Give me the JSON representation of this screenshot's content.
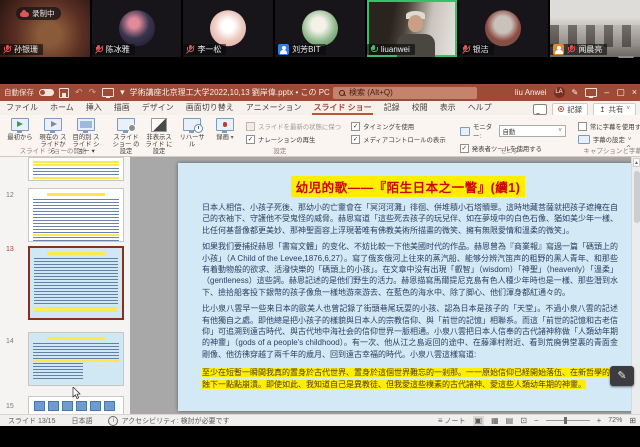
{
  "meeting": {
    "recording_badge": "录制中",
    "participants": [
      {
        "name": "孙银珊",
        "muted": true,
        "kind": "video"
      },
      {
        "name": "陈冰雅",
        "muted": true,
        "kind": "avatar"
      },
      {
        "name": "李一松",
        "muted": true,
        "kind": "avatar"
      },
      {
        "name": "刘芳BIT",
        "muted": false,
        "kind": "avatar",
        "badge": "person-blue"
      },
      {
        "name": "liuanwei",
        "muted": false,
        "speaking": true,
        "kind": "video"
      },
      {
        "name": "银洁",
        "muted": true,
        "kind": "avatar"
      },
      {
        "name": "闻晨亮",
        "muted": true,
        "kind": "video",
        "badge": "person-orange"
      }
    ],
    "accent_green": "#35c06a",
    "mute_red": "#e05656"
  },
  "powerpoint": {
    "titlebar": {
      "autosave_label": "自動保存",
      "autosave_state": "オフ",
      "filename": "学術講座北京理工大学2022,10,13 劉岸偉.pptx",
      "saved_status": "この PC に保存済み",
      "search_placeholder": "検索 (Alt+Q)",
      "user_name": "liu Anwei",
      "user_initials": "LA",
      "theme_color": "#9d4a37"
    },
    "tabs": [
      "ファイル",
      "ホーム",
      "挿入",
      "描画",
      "デザイン",
      "画面切り替え",
      "アニメーション",
      "スライド ショー",
      "記録",
      "校閲",
      "表示",
      "ヘルプ"
    ],
    "selected_tab": "スライド ショー",
    "tab_actions": {
      "record": "記録",
      "share": "共有"
    },
    "ribbon": {
      "buttons": {
        "from_beginning": "最初から",
        "from_current": "現在の スライドから",
        "custom_show": "目的別 スライド ショー ▾",
        "setup_show": "スライド ショー の設定",
        "hide_slide": "非表示スライド に設定",
        "rehearse": "リハーサル",
        "record": "録画"
      },
      "checkboxes": [
        {
          "label": "スライドを最新の状態に保つ",
          "checked": false,
          "disabled": true
        },
        {
          "label": "タイミングを使用",
          "checked": true
        },
        {
          "label": "ナレーションの再生",
          "checked": true
        },
        {
          "label": "メディアコントロールの表示",
          "checked": true
        }
      ],
      "monitor_label": "モニター:",
      "monitor_value": "自動",
      "presenter_checkbox": "発表者ツールを使用する",
      "subtitle_checkbox": "常に字幕を使用する",
      "subtitle_settings": "字幕の設定",
      "group_labels": [
        "スライド ショーの開始",
        "設定",
        "モニター",
        "キャプションと字幕"
      ]
    },
    "thumbnails": {
      "numbers": [
        "12",
        "13",
        "14",
        "15"
      ],
      "selected": "13"
    },
    "slide": {
      "title": "幼児的歌――『陌生日本之一瞥』(續1)",
      "paragraphs": [
        "日本人相信、小孩子死後、那幼小的亡靈會在「冥河河灘」徘徊、併堆積小石塔贖罪。這時地藏菩薩就把孩子遮掩在自己的衣袖下、守護他不受鬼怪的威脅。赫恩寫道「這些死去孩子的玩兒伴、如在夢境中的白色石像、猶如美少年一樣、比任何基督像都更美妙、那神聖面容上浮現著唯有佛教美術所描畫的微笑、擁有無限愛情和溫柔的微笑」。",
        "如果我们要捕捉赫恩「書寫文體」的变化、不妨比較一下他美國时代的作品。赫恩曾為『商業報』寫過一篇「碼頭上的小孩」（A Child of the Levee,1876,6,27）。寫了俄亥俄河上往來的蒸汽船、能够分辨汽笛声的粗野的黑人青年、和那些有着動物般的欲求、活潑快樂的「碼頭上的小孩」。在文章中没有出現「叡智」（wisdom）「神聖」（heavenly）「溫柔」（gentleness）這些詞。赫恩記述的是他们野生的活力。赫恩描寫馬爾提尼克島有色人種少年時也是一樣、那些潛到水下、撿拾船客投下銀幣的孩子像魚一樣地游來游去、在藍色的海水中、除了脚心、他们渾身都紅通々的。",
        "比小泉八雲早一些来日本的歐美人也曾記錄了街頭巷尾玩耍的小孩、認為日本是孩子的「天堂」。不過小泉八雲的記述有他獨自之處。即他總是把小孩子的樣貌與日本人的宗教信仰、與「前世的記憶」相聯系。而這「前世的記憶和古老信仰」可追溯到遠古時代、與古代地中海社会的信仰世界一脈相通。小泉八雲把日本人信奉的古代諸神称做「人類幼年期的神靈」（gods of a people's childhood）。有一次、他从江之島返回的途中、在藤澤村附近、看到荒廃佛堂裏的青面金剛像、他彷彿穿越了兩千年的歳月、回到遠古幸福的時代。小泉八雲這樣寫道:"
      ],
      "quote": "至少在短暫一瞬間我真的置身於古代世界、置身於這個世界難忘的一剎那。一一原始信仰已経開始落伍、在新哲學的侵蝕下一點點崩潰。即使如此、我知道自己是異教徒、但我愛這些樸素的古代諸神、愛這些人類幼年期的神靈。",
      "background_color": "#d3eaf6",
      "title_highlight": "#ffee00",
      "title_color": "#d00000"
    },
    "statusbar": {
      "slide_indicator": "スライド 13/15",
      "language": "日本語",
      "accessibility": "アクセシビリティ: 検討が必要です",
      "notes": "ノート",
      "zoom": "72%"
    }
  }
}
